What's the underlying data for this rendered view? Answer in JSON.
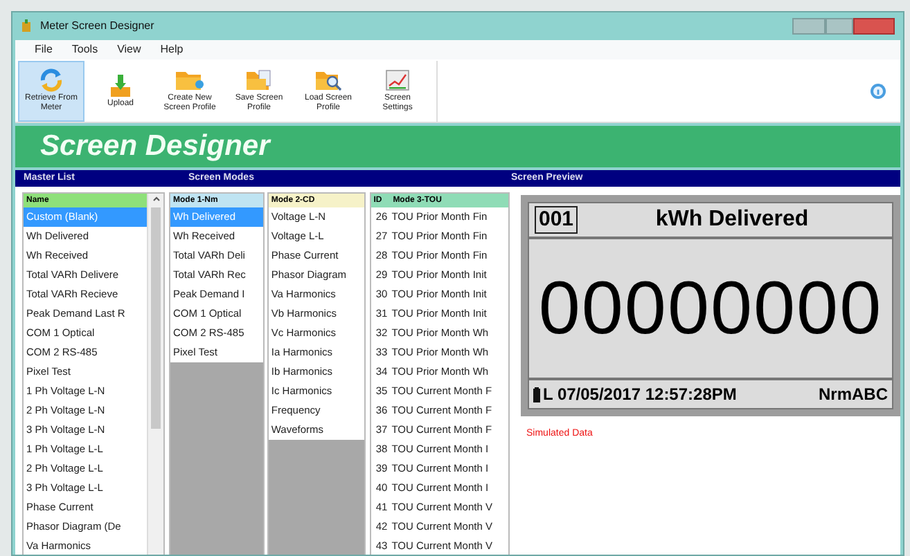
{
  "window": {
    "title": "Meter Screen Designer"
  },
  "menu": [
    "File",
    "Tools",
    "View",
    "Help"
  ],
  "toolbar": [
    {
      "kind": "retrieve",
      "label": "Retrieve From Meter",
      "selected": true
    },
    {
      "kind": "upload",
      "label": "Upload",
      "selected": false
    },
    {
      "kind": "create",
      "label": "Create New Screen Profile",
      "selected": false
    },
    {
      "kind": "save",
      "label": "Save Screen Profile",
      "selected": false
    },
    {
      "kind": "load",
      "label": "Load Screen Profile",
      "selected": false
    },
    {
      "kind": "settings",
      "label": "Screen Settings",
      "selected": false
    }
  ],
  "banner": "Screen Designer",
  "section_headers": [
    "Master List",
    "Screen Modes",
    "Screen Preview"
  ],
  "master_list": {
    "column": "Name",
    "items": [
      {
        "label": "Custom (Blank)",
        "selected": true
      },
      {
        "label": "Wh Delivered",
        "selected": false
      },
      {
        "label": "Wh Received",
        "selected": false
      },
      {
        "label": "Total VARh Delivere",
        "selected": false
      },
      {
        "label": "Total VARh Recieve",
        "selected": false
      },
      {
        "label": "Peak Demand Last R",
        "selected": false
      },
      {
        "label": "COM 1 Optical",
        "selected": false
      },
      {
        "label": "COM 2 RS-485",
        "selected": false
      },
      {
        "label": "Pixel Test",
        "selected": false
      },
      {
        "label": "1 Ph Voltage L-N",
        "selected": false
      },
      {
        "label": "2 Ph Voltage L-N",
        "selected": false
      },
      {
        "label": "3 Ph Voltage L-N",
        "selected": false
      },
      {
        "label": "1 Ph Voltage L-L",
        "selected": false
      },
      {
        "label": "2 Ph Voltage L-L",
        "selected": false
      },
      {
        "label": "3 Ph Voltage L-L",
        "selected": false
      },
      {
        "label": "Phase Current",
        "selected": false
      },
      {
        "label": "Phasor Diagram (De",
        "selected": false
      },
      {
        "label": "Va Harmonics",
        "selected": false
      }
    ]
  },
  "mode_1": {
    "column": "Mode 1-Nm",
    "items": [
      {
        "label": "Wh Delivered",
        "selected": true
      },
      {
        "label": "Wh Received",
        "selected": false
      },
      {
        "label": "Total VARh Deli",
        "selected": false
      },
      {
        "label": "Total VARh Rec",
        "selected": false
      },
      {
        "label": "Peak Demand I",
        "selected": false
      },
      {
        "label": "COM 1 Optical",
        "selected": false
      },
      {
        "label": "COM 2 RS-485",
        "selected": false
      },
      {
        "label": "Pixel Test",
        "selected": false
      }
    ]
  },
  "mode_2": {
    "column": "Mode 2-CD",
    "items": [
      {
        "label": "Voltage L-N",
        "selected": false
      },
      {
        "label": "Voltage L-L",
        "selected": false
      },
      {
        "label": "Phase Current",
        "selected": false
      },
      {
        "label": "Phasor Diagram",
        "selected": false
      },
      {
        "label": "Va Harmonics",
        "selected": false
      },
      {
        "label": "Vb Harmonics",
        "selected": false
      },
      {
        "label": "Vc Harmonics",
        "selected": false
      },
      {
        "label": "Ia Harmonics",
        "selected": false
      },
      {
        "label": "Ib Harmonics",
        "selected": false
      },
      {
        "label": "Ic Harmonics",
        "selected": false
      },
      {
        "label": "Frequency",
        "selected": false
      },
      {
        "label": "Waveforms",
        "selected": false
      }
    ]
  },
  "mode_3": {
    "columns": [
      "ID",
      "Mode 3-TOU"
    ],
    "rows": [
      {
        "id": "26",
        "label": "TOU Prior Month Fin",
        "selected": false
      },
      {
        "id": "27",
        "label": "TOU Prior Month Fin",
        "selected": false
      },
      {
        "id": "28",
        "label": "TOU Prior Month Fin",
        "selected": false
      },
      {
        "id": "29",
        "label": "TOU Prior Month Init",
        "selected": false
      },
      {
        "id": "30",
        "label": "TOU Prior Month Init",
        "selected": false
      },
      {
        "id": "31",
        "label": "TOU Prior Month Init",
        "selected": false
      },
      {
        "id": "32",
        "label": "TOU Prior Month Wh",
        "selected": false
      },
      {
        "id": "33",
        "label": "TOU Prior Month Wh",
        "selected": false
      },
      {
        "id": "34",
        "label": "TOU Prior Month Wh",
        "selected": false
      },
      {
        "id": "35",
        "label": "TOU Current Month F",
        "selected": false
      },
      {
        "id": "36",
        "label": "TOU Current Month F",
        "selected": false
      },
      {
        "id": "37",
        "label": "TOU Current Month F",
        "selected": false
      },
      {
        "id": "38",
        "label": "TOU Current Month I",
        "selected": false
      },
      {
        "id": "39",
        "label": "TOU Current Month I",
        "selected": false
      },
      {
        "id": "40",
        "label": "TOU Current Month I",
        "selected": false
      },
      {
        "id": "41",
        "label": "TOU Current Month V",
        "selected": false
      },
      {
        "id": "42",
        "label": "TOU Current Month V",
        "selected": false
      },
      {
        "id": "43",
        "label": "TOU Current Month V",
        "selected": false
      }
    ]
  },
  "preview": {
    "screen_number": "001",
    "title": "kWh Delivered",
    "value": "00000000",
    "status_line": "L 07/05/2017 12:57:28PM",
    "phase_status": "NrmABC",
    "note": "Simulated Data"
  }
}
